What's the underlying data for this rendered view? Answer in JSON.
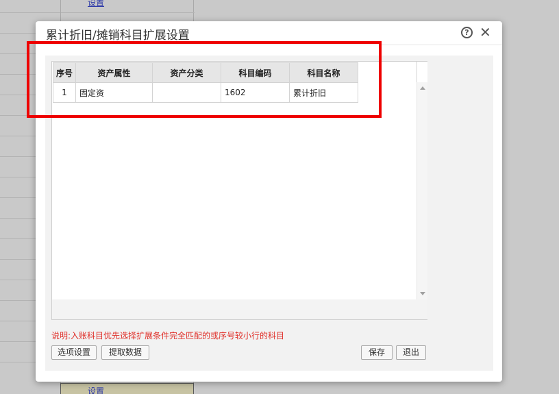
{
  "background": {
    "link_top": "设置",
    "link_bottom": "设置"
  },
  "dialog": {
    "title": "累计折旧/摊销科目扩展设置",
    "help_icon": "help-circle-icon",
    "close_icon": "close-icon",
    "table": {
      "columns": [
        "序号",
        "资产属性",
        "资产分类",
        "科目编码",
        "科目名称"
      ],
      "rows": [
        {
          "seq": "1",
          "attribute": "固定资",
          "category": "",
          "code": "1602",
          "name": "累计折旧"
        }
      ]
    },
    "note": "说明:入账科目优先选择扩展条件完全匹配的或序号较小行的科目",
    "buttons": {
      "options": "选项设置",
      "fetch": "提取数据",
      "save": "保存",
      "exit": "退出"
    }
  },
  "colors": {
    "highlight": "#ee0000",
    "note": "#e0302a",
    "link": "#2e3aa8"
  }
}
